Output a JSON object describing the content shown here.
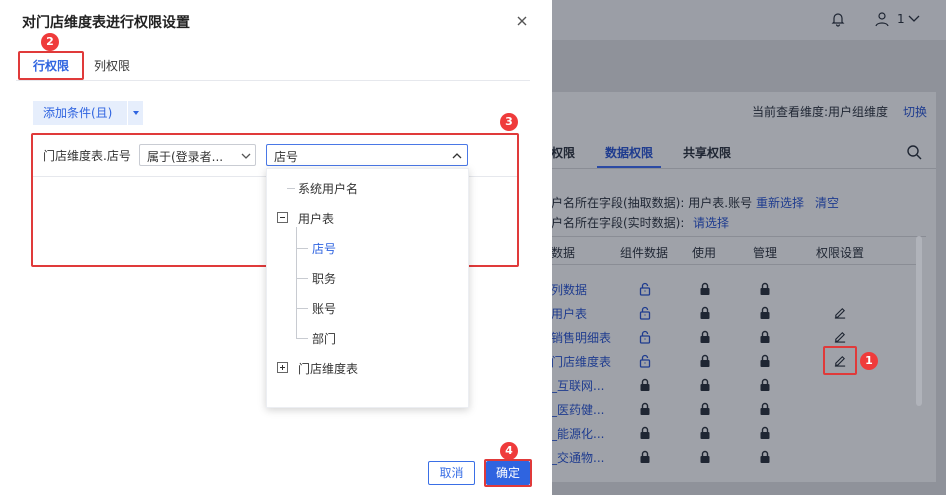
{
  "background": {
    "header": {
      "bell_icon": "bell-icon",
      "user_icon": "user-icon",
      "user_count": "1"
    },
    "view_info": {
      "label": "当前查看维度:用户组维度",
      "switch": "切换"
    },
    "tabs": [
      "权限",
      "数据权限",
      "共享权限"
    ],
    "field_rows": [
      {
        "label": "户名所在字段(抽取数据):",
        "value": "用户表.账号",
        "links": [
          "重新选择",
          "清空"
        ]
      },
      {
        "label": "户名所在字段(实时数据):",
        "value": "",
        "links": [
          "请选择"
        ]
      }
    ],
    "table": {
      "headers": [
        "数据",
        "组件数据",
        "使用",
        "管理",
        "权限设置"
      ],
      "rows": [
        {
          "name": "列数据",
          "component": "unlock-icon",
          "edit": false
        },
        {
          "name": "用户表",
          "component": "unlock-icon",
          "edit": true
        },
        {
          "name": "销售明细表",
          "component": "unlock-icon",
          "edit": true
        },
        {
          "name": "门店维度表",
          "component": "unlock-icon",
          "edit": true
        },
        {
          "name": "_互联网...",
          "component": "lock-icon",
          "edit": false
        },
        {
          "name": "_医药健...",
          "component": "lock-icon",
          "edit": false
        },
        {
          "name": "_能源化...",
          "component": "lock-icon",
          "edit": false
        },
        {
          "name": "_交通物...",
          "component": "lock-icon",
          "edit": false
        }
      ]
    },
    "marker_edit": "1"
  },
  "dialog": {
    "title": "对门店维度表进行权限设置",
    "tabs": {
      "row": "行权限",
      "column": "列权限"
    },
    "markers": {
      "tab": "2",
      "condition": "3",
      "confirm": "4"
    },
    "add_condition": "添加条件(且)",
    "condition": {
      "field": "门店维度表.店号",
      "operator": "属于(登录者...",
      "value": "店号"
    },
    "tree": {
      "items": [
        {
          "label": "系统用户名"
        },
        {
          "label": "用户表"
        },
        {
          "label": "店号"
        },
        {
          "label": "职务"
        },
        {
          "label": "账号"
        },
        {
          "label": "部门"
        },
        {
          "label": "门店维度表"
        }
      ]
    },
    "buttons": {
      "cancel": "取消",
      "confirm": "确定"
    }
  },
  "colors": {
    "accent": "#2f64e0",
    "marker_red": "#ef3b3b"
  }
}
